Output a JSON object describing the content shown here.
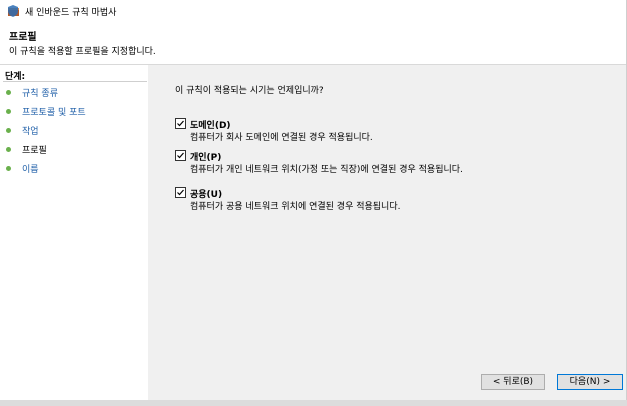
{
  "window": {
    "title": "새 인바운드 규칙 마법사"
  },
  "header": {
    "title": "프로필",
    "description": "이 규칙을 적용할 프로필을 지정합니다."
  },
  "sidebar": {
    "steps_title": "단계:",
    "steps": [
      {
        "label": "규칙 종류",
        "current": false
      },
      {
        "label": "프로토콜 및 포트",
        "current": false
      },
      {
        "label": "작업",
        "current": false
      },
      {
        "label": "프로필",
        "current": true
      },
      {
        "label": "이름",
        "current": false
      }
    ]
  },
  "main": {
    "question": "이 규칙이 적용되는 시기는 언제입니까?",
    "options": [
      {
        "title": "도메인(D)",
        "description": "컴퓨터가 회사 도메인에 연결된 경우 적용됩니다.",
        "checked": true
      },
      {
        "title": "개인(P)",
        "description": "컴퓨터가 개인 네트워크 위치(가정 또는 직장)에 연결된 경우 적용됩니다.",
        "checked": true
      },
      {
        "title": "공용(U)",
        "description": "컴퓨터가 공용 네트워크 위치에 연결된 경우 적용됩니다.",
        "checked": true
      }
    ]
  },
  "buttons": {
    "back": "< 뒤로(B)",
    "next": "다음(N) >"
  },
  "colors": {
    "accent": "#0078d7",
    "link": "#1f5fa8",
    "step_dot": "#6ab04c"
  }
}
